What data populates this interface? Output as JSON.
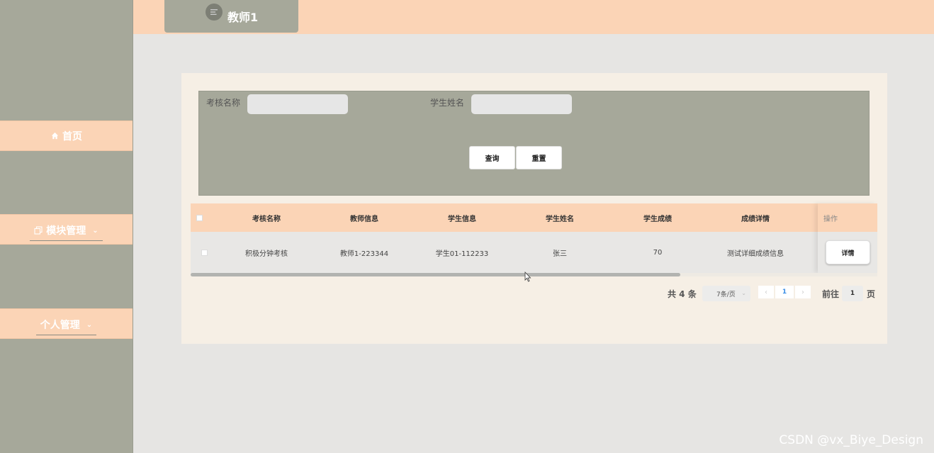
{
  "header": {
    "tab_label": "教师1"
  },
  "sidebar": {
    "items": [
      {
        "label": "首页",
        "icon": "home-icon"
      },
      {
        "label": "模块管理",
        "icon": "copy-icon",
        "has_dropdown": true
      },
      {
        "label": "个人管理",
        "has_dropdown": true
      }
    ]
  },
  "search": {
    "field1_label": "考核名称",
    "field1_value": "",
    "field2_label": "学生姓名",
    "field2_value": "",
    "query_button": "查询",
    "reset_button": "重置"
  },
  "table": {
    "columns": [
      "考核名称",
      "教师信息",
      "学生信息",
      "学生姓名",
      "学生成绩",
      "成绩详情"
    ],
    "action_column": "操作",
    "rows": [
      {
        "cells": [
          "积极分钟考核",
          "教师1-223344",
          "学生01-112233",
          "张三",
          "70",
          "测试详细成绩信息"
        ],
        "action": "详情"
      }
    ]
  },
  "pagination": {
    "total": "共 4 条",
    "page_size": "7条/页",
    "current_page": "1",
    "goto_prefix": "前往",
    "goto_value": "1",
    "goto_suffix": "页"
  },
  "watermark": "CSDN @vx_Biye_Design",
  "colors": {
    "accent": "#fbd4b6",
    "sidebar": "#a6a89a",
    "panel": "#f6efe5",
    "background": "#e6e5e3"
  }
}
